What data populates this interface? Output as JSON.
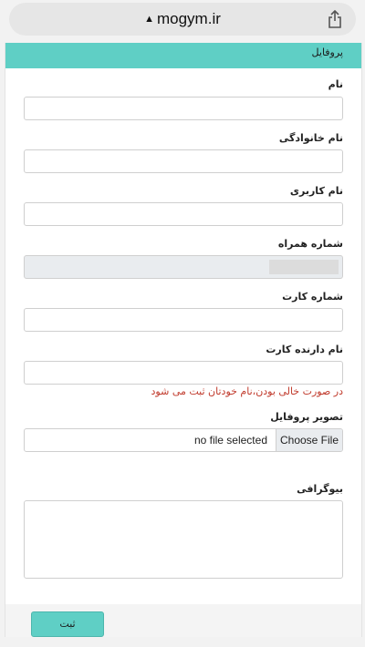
{
  "browser": {
    "host": "mogym.ir",
    "lock_glyph": "▲",
    "share_icon": "share-icon"
  },
  "card": {
    "title": "پروفایل"
  },
  "fields": {
    "first_name": {
      "label": "نام",
      "value": ""
    },
    "last_name": {
      "label": "نام خانوادگی",
      "value": ""
    },
    "username": {
      "label": "نام کاربری",
      "value": ""
    },
    "mobile": {
      "label": "شماره همراه",
      "value": ""
    },
    "card_number": {
      "label": "شماره کارت",
      "value": ""
    },
    "card_holder": {
      "label": "نام دارنده کارت",
      "value": "",
      "hint": "در صورت خالی بودن،نام خودتان ثبت می شود"
    },
    "avatar": {
      "label": "تصویر پروفایل",
      "status": "no file selected",
      "button": "Choose File"
    },
    "bio": {
      "label": "بیوگرافی",
      "value": ""
    }
  },
  "submit_label": "ثبت",
  "colors": {
    "accent": "#5fcfc5",
    "hint": "#c0392b"
  }
}
